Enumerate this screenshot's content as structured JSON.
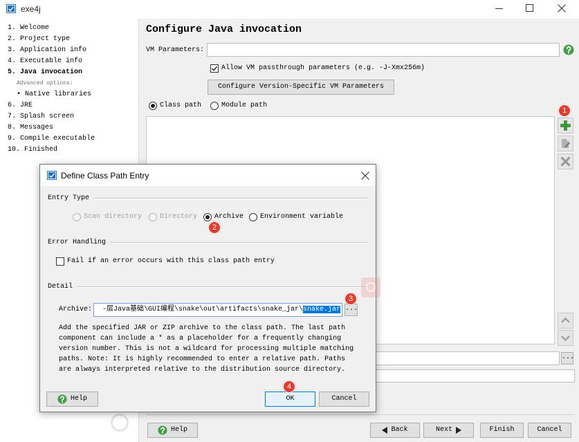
{
  "window": {
    "title": "exe4j"
  },
  "steps": [
    {
      "label": "1. Welcome"
    },
    {
      "label": "2. Project type"
    },
    {
      "label": "3. Application info"
    },
    {
      "label": "4. Executable info"
    },
    {
      "label": "5. Java invocation"
    },
    {
      "label": "6. JRE"
    },
    {
      "label": "7. Splash screen"
    },
    {
      "label": "8. Messages"
    },
    {
      "label": "9. Compile executable"
    },
    {
      "label": "10. Finished"
    }
  ],
  "advanced": {
    "heading": "Advanced options:",
    "items": [
      {
        "label": "• Native libraries"
      }
    ]
  },
  "main": {
    "title": "Configure Java invocation",
    "vm_parameters": {
      "label": "VM Parameters:",
      "value": ""
    },
    "passthrough": {
      "label": "Allow VM passthrough parameters (e.g. -J-Xmx256m)",
      "checked": true
    },
    "configure_button": "Configure Version-Specific VM Parameters",
    "path_mode": [
      {
        "label": "Class path",
        "selected": true
      },
      {
        "label": "Module path",
        "selected": false
      }
    ],
    "class_path_entries": [],
    "browse_label": "..."
  },
  "nav": {
    "help": "Help",
    "back": "Back",
    "next": "Next",
    "finish": "Finish",
    "cancel": "Cancel"
  },
  "dialog": {
    "title": "Define Class Path Entry",
    "entry_type": {
      "heading": "Entry Type",
      "options": [
        {
          "label": "Scan directory",
          "enabled": false,
          "selected": false
        },
        {
          "label": "Directory",
          "enabled": false,
          "selected": false
        },
        {
          "label": "Archive",
          "enabled": true,
          "selected": true
        },
        {
          "label": "Environment variable",
          "enabled": true,
          "selected": false
        }
      ]
    },
    "error_handling": {
      "heading": "Error Handling",
      "fail_label": "Fail if an error occurs with this class path entry",
      "checked": false
    },
    "detail": {
      "heading": "Detail",
      "archive_label": "Archive:",
      "archive_value": "-层Java基础\\GUI编程\\snake\\out\\artifacts\\snake_jar\\",
      "archive_selected": "snake.jar",
      "browse_label": "...",
      "description": [
        "Add the specified JAR or ZIP archive to the class path. The last path",
        "component can include a * as a placeholder for a frequently changing",
        "version number. This is not a wildcard for processing multiple matching",
        "paths. Note: It is highly recommended to enter a relative path. Paths",
        "are always interpreted relative to the distribution source directory."
      ]
    },
    "buttons": {
      "help": "Help",
      "ok": "OK",
      "cancel": "Cancel"
    }
  },
  "annotations": [
    "1",
    "2",
    "3",
    "4"
  ],
  "colors": {
    "accent": "#0078d7",
    "help_green": "#43a047",
    "marker_red": "#e33b2e"
  }
}
